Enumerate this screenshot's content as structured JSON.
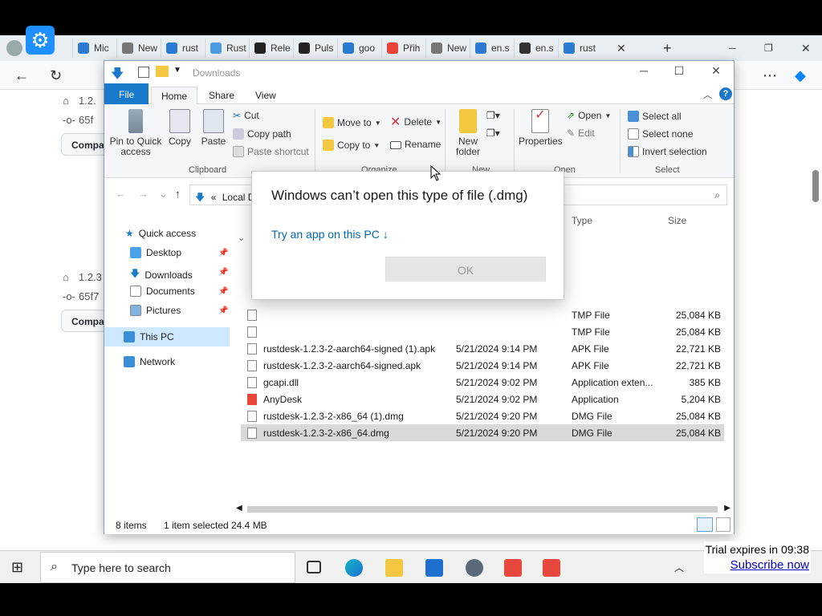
{
  "browser": {
    "tabs": [
      {
        "label": "Mic",
        "color": "#2b7bd3"
      },
      {
        "label": "New",
        "color": "#777"
      },
      {
        "label": "rust",
        "color": "#2b7bd3"
      },
      {
        "label": "Rust",
        "color": "#4a9be0"
      },
      {
        "label": "Rele",
        "color": "#222"
      },
      {
        "label": "Puls",
        "color": "#222"
      },
      {
        "label": "goo",
        "color": "#2b7bd3"
      },
      {
        "label": "Přih",
        "color": "#ea4335"
      },
      {
        "label": "New",
        "color": "#777"
      },
      {
        "label": "en.s",
        "color": "#2b7bd3"
      },
      {
        "label": "en.s",
        "color": "#333"
      },
      {
        "label": "rust",
        "color": "#2b7bd3"
      }
    ],
    "page_lines": [
      "1.2.",
      "65f",
      "Compa",
      "1.2.3",
      "65f7",
      "Compar"
    ]
  },
  "explorer": {
    "title": "Downloads",
    "ribbon_tabs": {
      "file": "File",
      "home": "Home",
      "share": "Share",
      "view": "View"
    },
    "clipboard": {
      "pin": "Pin to Quick access",
      "copy": "Copy",
      "paste": "Paste",
      "cut": "Cut",
      "copy_path": "Copy path",
      "paste_shortcut": "Paste shortcut",
      "label": "Clipboard"
    },
    "organize": {
      "move_to": "Move to",
      "copy_to": "Copy to",
      "delete": "Delete",
      "rename": "Rename",
      "label": "Organize"
    },
    "new": {
      "new_folder": "New folder",
      "label": "New"
    },
    "open": {
      "properties": "Properties",
      "open": "Open",
      "edit": "Edit",
      "label": "Open"
    },
    "select": {
      "select_all": "Select all",
      "select_none": "Select none",
      "invert": "Invert selection",
      "label": "Select"
    },
    "address": "Local D",
    "nav": [
      {
        "label": "Quick access",
        "indent": 0
      },
      {
        "label": "Desktop",
        "indent": 1
      },
      {
        "label": "Downloads",
        "indent": 1
      },
      {
        "label": "Documents",
        "indent": 1
      },
      {
        "label": "Pictures",
        "indent": 1
      },
      {
        "label": "This PC",
        "indent": 0
      },
      {
        "label": "Network",
        "indent": 0
      }
    ],
    "columns": {
      "type": "Type",
      "size": "Size"
    },
    "files": [
      {
        "name": "",
        "date": "",
        "type": "TMP File",
        "size": "25,084 KB"
      },
      {
        "name": "",
        "date": "",
        "type": "TMP File",
        "size": "25,084 KB"
      },
      {
        "name": "rustdesk-1.2.3-2-aarch64-signed (1).apk",
        "date": "5/21/2024 9:14 PM",
        "type": "APK File",
        "size": "22,721 KB"
      },
      {
        "name": "rustdesk-1.2.3-2-aarch64-signed.apk",
        "date": "5/21/2024 9:14 PM",
        "type": "APK File",
        "size": "22,721 KB"
      },
      {
        "name": "gcapi.dll",
        "date": "5/21/2024 9:02 PM",
        "type": "Application exten...",
        "size": "385 KB"
      },
      {
        "name": "AnyDesk",
        "date": "5/21/2024 9:02 PM",
        "type": "Application",
        "size": "5,204 KB"
      },
      {
        "name": "rustdesk-1.2.3-2-x86_64 (1).dmg",
        "date": "5/21/2024 9:20 PM",
        "type": "DMG File",
        "size": "25,084 KB"
      },
      {
        "name": "rustdesk-1.2.3-2-x86_64.dmg",
        "date": "5/21/2024 9:20 PM",
        "type": "DMG File",
        "size": "25,084 KB"
      }
    ],
    "status": {
      "items": "8 items",
      "selected": "1 item selected",
      "size": "24.4 MB"
    }
  },
  "dialog": {
    "title": "Windows can’t open this type of file (.dmg)",
    "link": "Try an app on this PC ↓",
    "ok": "OK"
  },
  "taskbar": {
    "search_placeholder": "Type here to search",
    "trial": "Trial expires in 09:38",
    "subscribe": "Subscribe now"
  }
}
